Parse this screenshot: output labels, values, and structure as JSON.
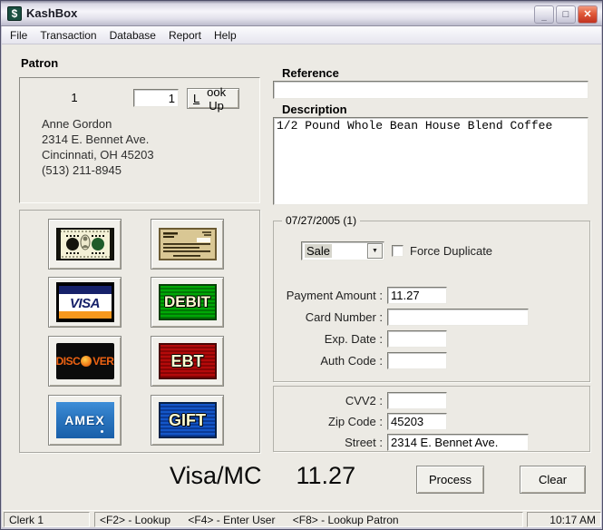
{
  "window": {
    "title": "KashBox",
    "icons": {
      "app_dollar": "$",
      "minimize": "_",
      "maximize": "□",
      "close": "✕",
      "dropdown_arrow": "▼"
    }
  },
  "menu": {
    "items": [
      "File",
      "Transaction",
      "Database",
      "Report",
      "Help"
    ]
  },
  "patron": {
    "section_label": "Patron",
    "record_number": "1",
    "lookup_value": "1",
    "lookup_button_accel": "L",
    "lookup_button_rest": "ook Up",
    "name": "Anne Gordon",
    "address": "2314 E. Bennet Ave.",
    "city_state_zip": "Cincinnati, OH 45203",
    "phone": "(513) 211-8945"
  },
  "reference": {
    "label": "Reference",
    "value": ""
  },
  "description": {
    "label": "Description",
    "value": "1/2 Pound Whole Bean House Blend Coffee"
  },
  "payment_buttons": {
    "visa_label": "VISA",
    "debit_label": "DEBIT",
    "discover_pre": "DISC",
    "discover_post": "VER",
    "ebt_label": "EBT",
    "amex_label": "AMEX",
    "gift_label": "GIFT"
  },
  "transaction": {
    "group_caption": "07/27/2005  (1)",
    "type_selected": "Sale",
    "force_duplicate_label": "Force Duplicate",
    "fields": [
      {
        "label": "Payment Amount :",
        "value": "11.27"
      },
      {
        "label": "Card Number :",
        "value": ""
      },
      {
        "label": "Exp. Date :",
        "value": ""
      },
      {
        "label": "Auth Code :",
        "value": ""
      }
    ]
  },
  "verification": {
    "fields": [
      {
        "label": "CVV2 :",
        "value": ""
      },
      {
        "label": "Zip Code :",
        "value": "45203"
      },
      {
        "label": "Street :",
        "value": "2314 E. Bennet Ave."
      }
    ]
  },
  "summary": {
    "card_type": "Visa/MC",
    "amount": "11.27"
  },
  "actions": {
    "process": "Process",
    "clear": "Clear"
  },
  "statusbar": {
    "clerk": "Clerk 1",
    "hotkeys": [
      "<F2> - Lookup",
      "<F4> - Enter User",
      "<F8> - Lookup Patron"
    ],
    "time": "10:17 AM"
  },
  "colors": {
    "title_icon_green": "#1B4F41",
    "close_red": "#C13220",
    "visa_navy": "#16216A",
    "visa_orange": "#F7981D",
    "debit_green": "#00A000",
    "ebt_red": "#A00000",
    "amex_blue": "#2E7AC4",
    "gift_blue": "#1050C0",
    "discover_orange": "#EE6212"
  }
}
